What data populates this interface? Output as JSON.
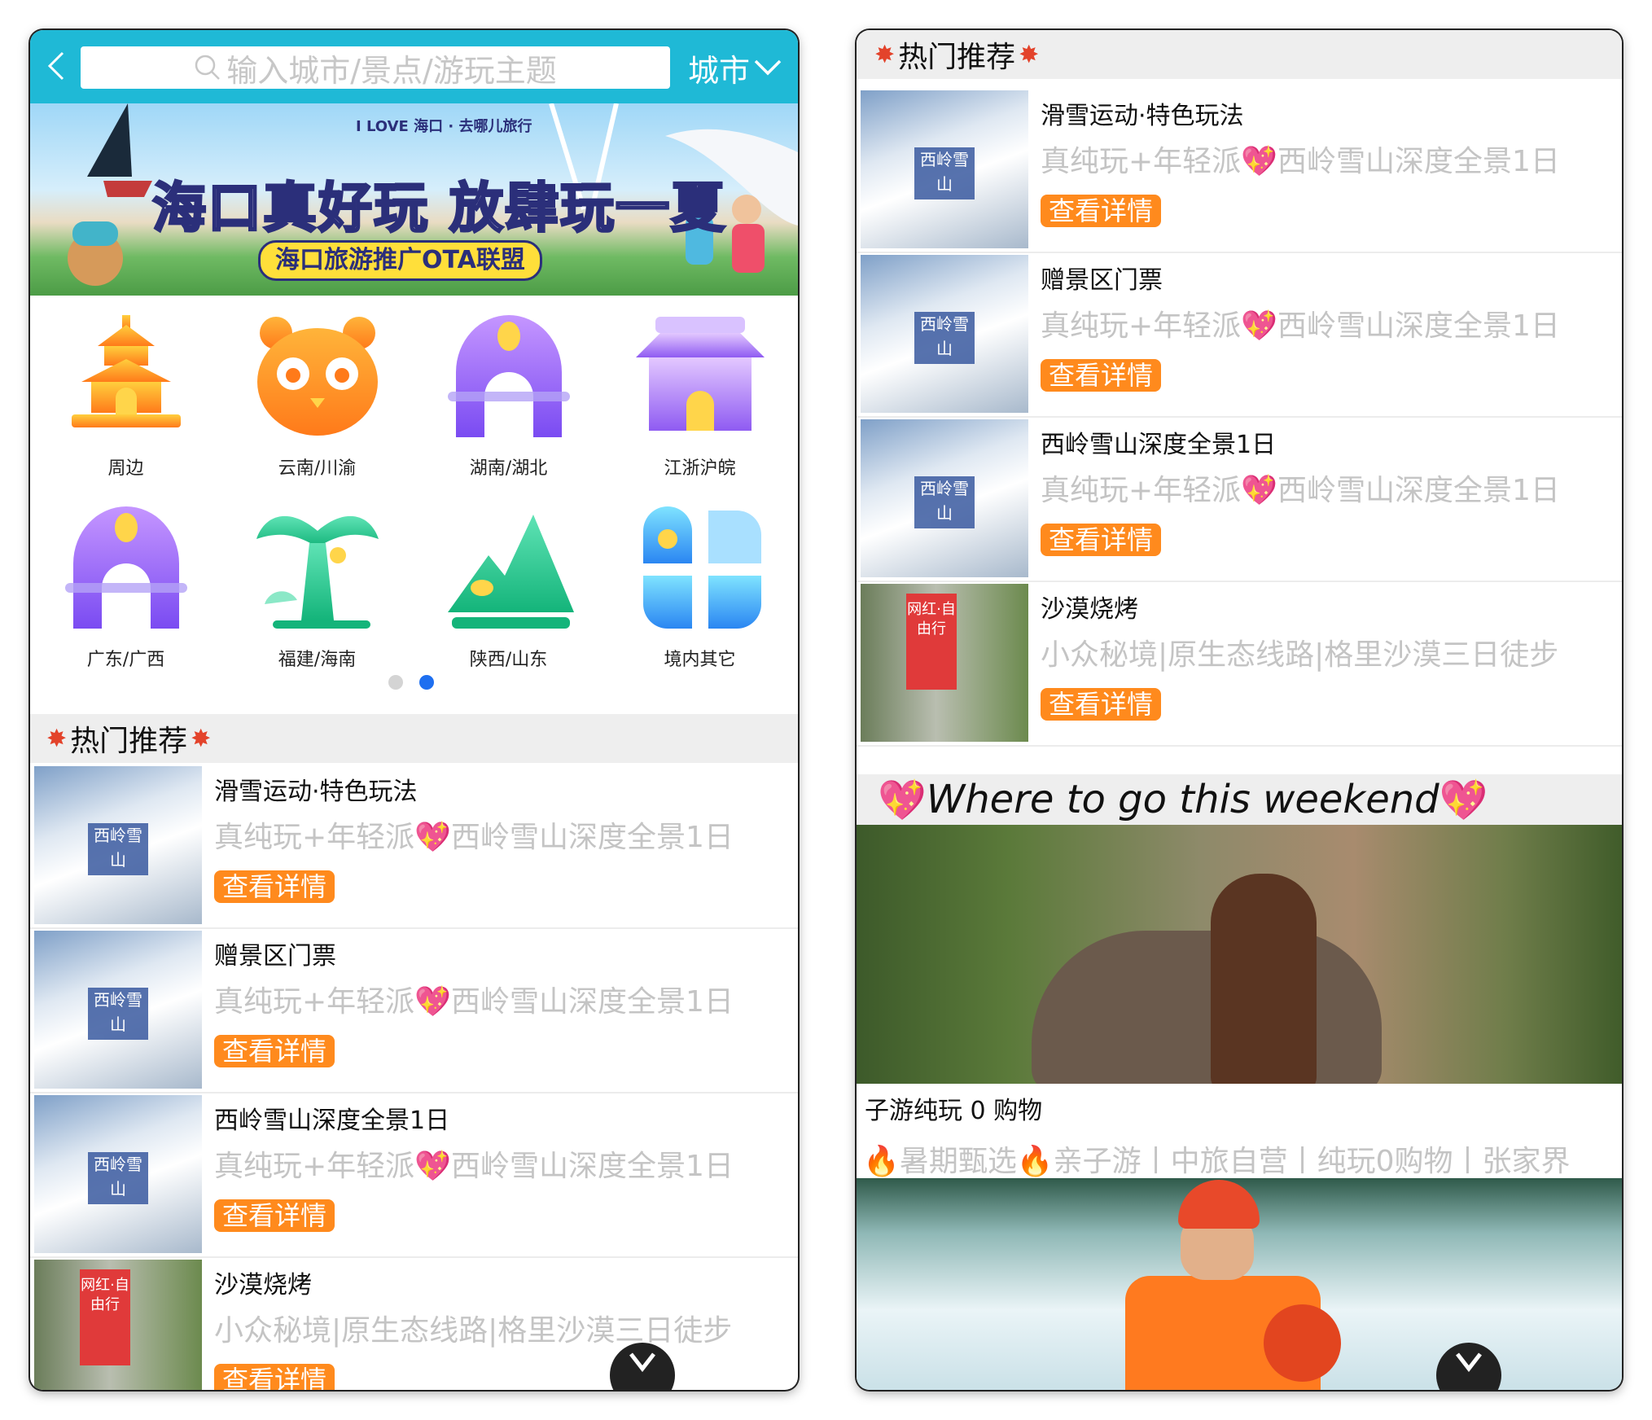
{
  "left": {
    "search": {
      "placeholder": "输入城市/景点/游玩主题",
      "city_label": "城市"
    },
    "banner": {
      "title": "海口真好玩 放肆玩一夏",
      "subtitle": "海口旅游推广OTA联盟",
      "logo_text": "I LOVE 海口 · 去哪儿旅行"
    },
    "categories": [
      {
        "label": "周边",
        "icon": "temple-icon"
      },
      {
        "label": "云南/川渝",
        "icon": "panda-icon"
      },
      {
        "label": "湖南/湖北",
        "icon": "arch-icon"
      },
      {
        "label": "江浙沪皖",
        "icon": "pavilion-icon"
      },
      {
        "label": "广东/广西",
        "icon": "arch-icon"
      },
      {
        "label": "福建/海南",
        "icon": "palm-icon"
      },
      {
        "label": "陕西/山东",
        "icon": "mountain-icon"
      },
      {
        "label": "境内其它",
        "icon": "clover-icon"
      }
    ],
    "pager": {
      "count": 2,
      "active": 2
    },
    "hot": {
      "title": "热门推荐",
      "items": [
        {
          "title": "滑雪运动·特色玩法",
          "subtitle": "真纯玩+年轻派💖西岭雪山深度全景1日",
          "button": "查看详情",
          "thumb": "ski",
          "thumb_text": "西岭雪山"
        },
        {
          "title": "赠景区门票",
          "subtitle": "真纯玩+年轻派💖西岭雪山深度全景1日",
          "button": "查看详情",
          "thumb": "ski",
          "thumb_text": "西岭雪山"
        },
        {
          "title": "西岭雪山深度全景1日",
          "subtitle": "真纯玩+年轻派💖西岭雪山深度全景1日",
          "button": "查看详情",
          "thumb": "ski",
          "thumb_text": "西岭雪山"
        },
        {
          "title": "沙漠烧烤",
          "subtitle": "小众秘境|原生态线路|格里沙漠三日徒步",
          "button": "查看详情",
          "thumb": "desert",
          "thumb_text": "网红·自由行"
        }
      ]
    }
  },
  "right": {
    "hot": {
      "title": "热门推荐",
      "items": [
        {
          "title": "滑雪运动·特色玩法",
          "subtitle": "真纯玩+年轻派💖西岭雪山深度全景1日",
          "button": "查看详情",
          "thumb": "ski",
          "thumb_text": "西岭雪山"
        },
        {
          "title": "赠景区门票",
          "subtitle": "真纯玩+年轻派💖西岭雪山深度全景1日",
          "button": "查看详情",
          "thumb": "ski",
          "thumb_text": "西岭雪山"
        },
        {
          "title": "西岭雪山深度全景1日",
          "subtitle": "真纯玩+年轻派💖西岭雪山深度全景1日",
          "button": "查看详情",
          "thumb": "ski",
          "thumb_text": "西岭雪山"
        },
        {
          "title": "沙漠烧烤",
          "subtitle": "小众秘境|原生态线路|格里沙漠三日徒步",
          "button": "查看详情",
          "thumb": "desert",
          "thumb_text": "网红·自由行"
        }
      ]
    },
    "weekend": {
      "title": "Where to go this weekend",
      "items": [
        {
          "caption": "子游纯玩 0 购物",
          "subtitle": "🔥暑期甄选🔥亲子游丨中旅自营丨纯玩0购物丨张家界"
        }
      ]
    }
  },
  "colors": {
    "topbar": "#1fb9d6",
    "button": "#ff8a1d",
    "section_bg": "#eeeeee",
    "muted_text": "#c4c4c4",
    "pager_active": "#1e6ff0"
  }
}
